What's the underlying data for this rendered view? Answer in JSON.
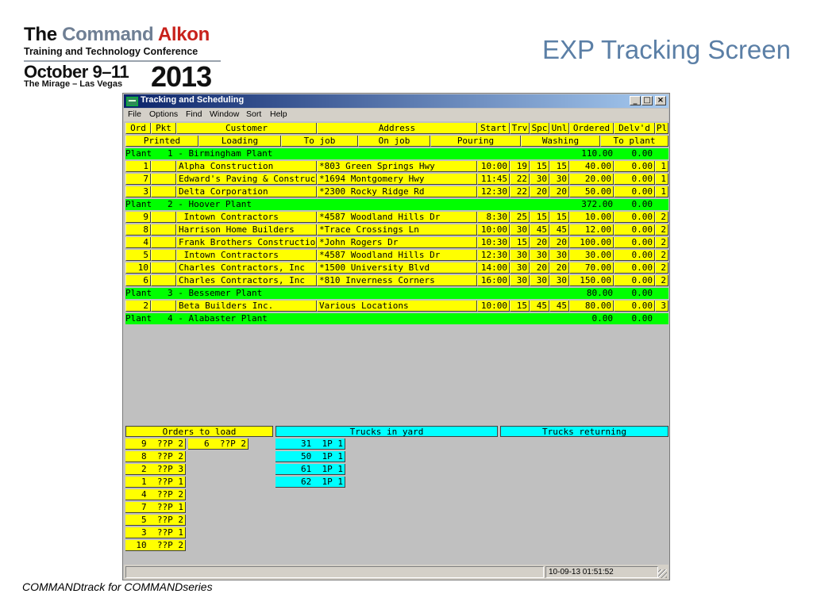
{
  "slide": {
    "logo": {
      "line1_a": "The ",
      "line1_b": "Command ",
      "line1_c": "Alkon",
      "line2": "Training and Technology Conference",
      "line3": "October 9–11",
      "line4": "The Mirage – Las Vegas",
      "year": "2013"
    },
    "title": "EXP Tracking Screen",
    "caption": "COMMANDtrack for COMMANDseries"
  },
  "window": {
    "title": "Tracking and Scheduling",
    "controls": [
      "_",
      "□",
      "×"
    ],
    "menu": [
      "File",
      "Options",
      "Find",
      "Window",
      "Sort",
      "Help"
    ]
  },
  "columns": [
    "Ord",
    "Pkt",
    "Customer",
    "Address",
    "Start",
    "Trv",
    "Spc",
    "Unl",
    "Ordered",
    "Delv'd",
    "Pl"
  ],
  "statuses": [
    "Printed",
    "Loading",
    "To job",
    "On job",
    "Pouring",
    "Washing",
    "To plant"
  ],
  "plants": [
    {
      "label": "Plant   1 - Birmingham Plant",
      "ordered": "110.00",
      "delivered": "0.00",
      "orders": [
        {
          "ord": "1",
          "pkt": "",
          "customer": "Alpha Construction",
          "address": "*803 Green Springs Hwy",
          "start": "10:00",
          "trv": "19",
          "spc": "15",
          "unl": "15",
          "ordered": "40.00",
          "delvd": "0.00",
          "pl": "1"
        },
        {
          "ord": "7",
          "pkt": "",
          "customer": "Edward's Paving & Construc",
          "address": "*1694 Montgomery Hwy",
          "start": "11:45",
          "trv": "22",
          "spc": "30",
          "unl": "30",
          "ordered": "20.00",
          "delvd": "0.00",
          "pl": "1"
        },
        {
          "ord": "3",
          "pkt": "",
          "customer": "Delta Corporation",
          "address": "*2300 Rocky Ridge Rd",
          "start": "12:30",
          "trv": "22",
          "spc": "20",
          "unl": "20",
          "ordered": "50.00",
          "delvd": "0.00",
          "pl": "1"
        }
      ]
    },
    {
      "label": "Plant   2 - Hoover Plant",
      "ordered": "372.00",
      "delivered": "0.00",
      "orders": [
        {
          "ord": "9",
          "pkt": "",
          "customer": " Intown Contractors",
          "address": "*4587 Woodland Hills Dr",
          "start": "8:30",
          "trv": "25",
          "spc": "15",
          "unl": "15",
          "ordered": "10.00",
          "delvd": "0.00",
          "pl": "2"
        },
        {
          "ord": "8",
          "pkt": "",
          "customer": "Harrison Home Builders",
          "address": "*Trace Crossings Ln",
          "start": "10:00",
          "trv": "30",
          "spc": "45",
          "unl": "45",
          "ordered": "12.00",
          "delvd": "0.00",
          "pl": "2"
        },
        {
          "ord": "4",
          "pkt": "",
          "customer": "Frank Brothers Constructio",
          "address": "*John Rogers Dr",
          "start": "10:30",
          "trv": "15",
          "spc": "20",
          "unl": "20",
          "ordered": "100.00",
          "delvd": "0.00",
          "pl": "2"
        },
        {
          "ord": "5",
          "pkt": "",
          "customer": " Intown Contractors",
          "address": "*4587 Woodland Hills Dr",
          "start": "12:30",
          "trv": "30",
          "spc": "30",
          "unl": "30",
          "ordered": "30.00",
          "delvd": "0.00",
          "pl": "2"
        },
        {
          "ord": "10",
          "pkt": "",
          "customer": "Charles Contractors, Inc",
          "address": "*1500 University Blvd",
          "start": "14:00",
          "trv": "30",
          "spc": "20",
          "unl": "20",
          "ordered": "70.00",
          "delvd": "0.00",
          "pl": "2"
        },
        {
          "ord": "6",
          "pkt": "",
          "customer": "Charles Contractors, Inc",
          "address": "*810 Inverness Corners",
          "start": "16:00",
          "trv": "30",
          "spc": "30",
          "unl": "30",
          "ordered": "150.00",
          "delvd": "0.00",
          "pl": "2"
        }
      ]
    },
    {
      "label": "Plant   3 - Bessemer Plant",
      "ordered": "80.00",
      "delivered": "0.00",
      "orders": [
        {
          "ord": "2",
          "pkt": "",
          "customer": "Beta Builders Inc.",
          "address": "Various Locations",
          "start": "10:00",
          "trv": "15",
          "spc": "45",
          "unl": "45",
          "ordered": "80.00",
          "delvd": "0.00",
          "pl": "3"
        }
      ]
    },
    {
      "label": "Plant   4 - Alabaster Plant",
      "ordered": "0.00",
      "delivered": "0.00",
      "orders": []
    }
  ],
  "bottom": {
    "orders_to_load_title": "Orders to load",
    "trucks_in_yard_title": "Trucks in yard",
    "trucks_returning_title": "Trucks returning",
    "orders_to_load": [
      "9  ??P 2",
      "8  ??P 2",
      "2  ??P 3",
      "1  ??P 1",
      "4  ??P 2",
      "7  ??P 1",
      "5  ??P 2",
      "3  ??P 1",
      "10  ??P 2"
    ],
    "orders_to_load_extra": [
      "6  ??P 2"
    ],
    "trucks_in_yard": [
      "31  1P 1",
      "50  1P 1",
      "61  1P 1",
      "62  1P 1"
    ]
  },
  "statusbar": {
    "datetime": "10-09-13 01:51:52"
  },
  "colors": {
    "grid_yellow": "#ffff00",
    "plant_green": "#00ff00",
    "yard_cyan": "#00ffff",
    "window_gray": "#c0c0c0"
  }
}
